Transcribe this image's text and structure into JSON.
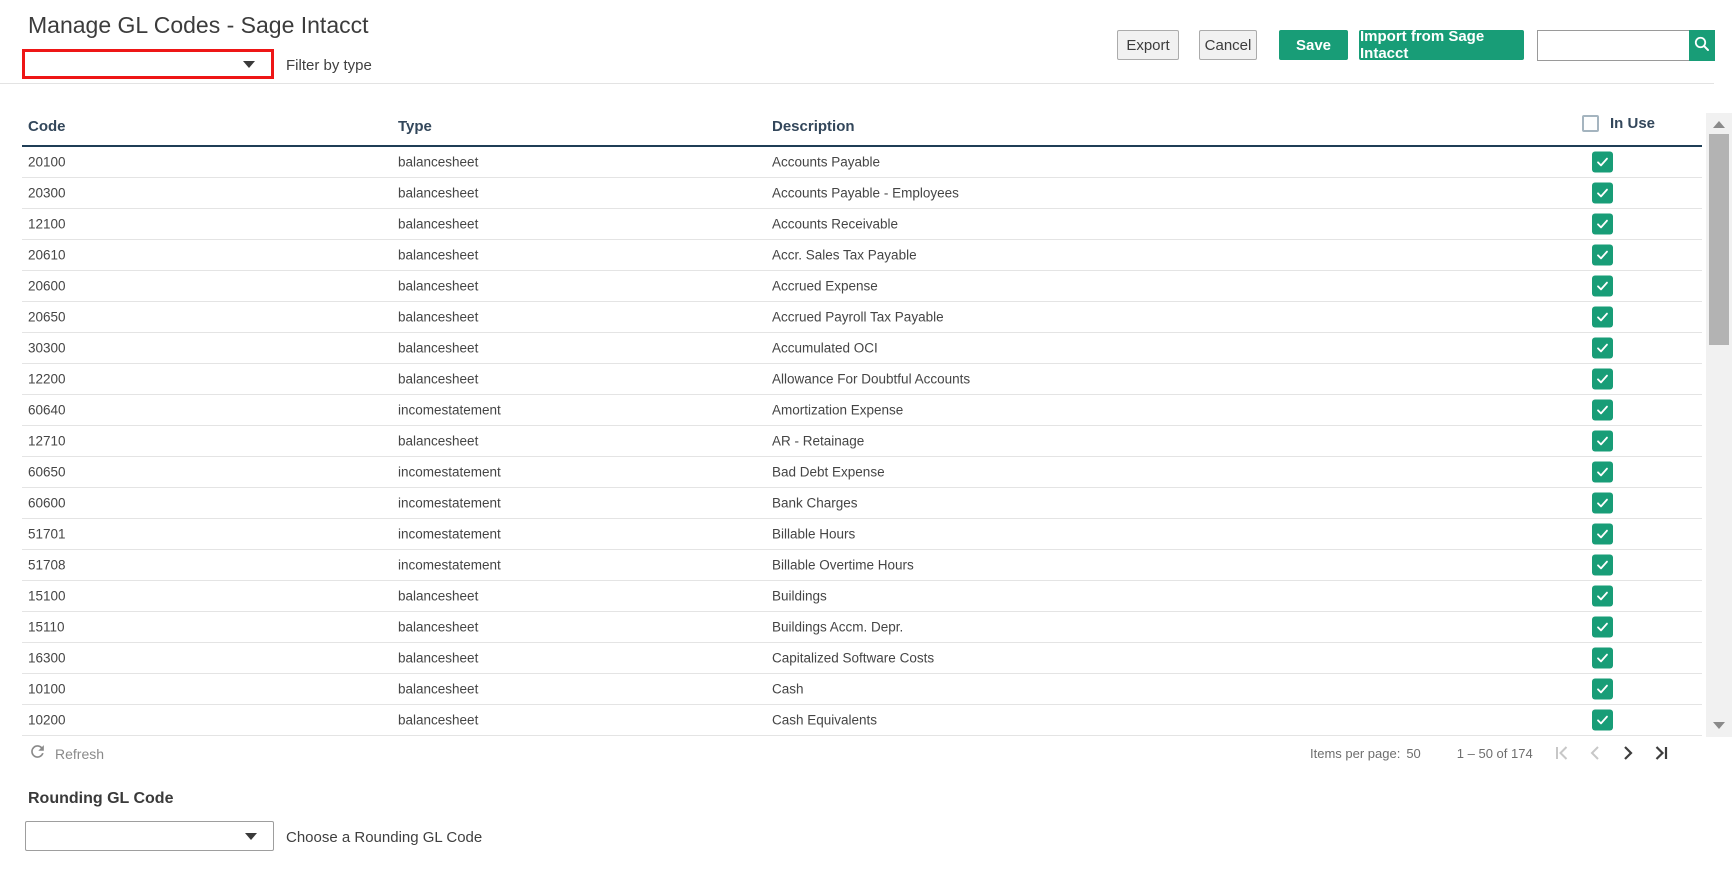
{
  "page": {
    "title": "Manage GL Codes - Sage Intacct"
  },
  "filter": {
    "value": "",
    "label": "Filter by type"
  },
  "toolbar": {
    "export_label": "Export",
    "cancel_label": "Cancel",
    "save_label": "Save",
    "import_label": "Import from Sage Intacct",
    "search_value": ""
  },
  "table": {
    "columns": {
      "code": "Code",
      "type": "Type",
      "description": "Description",
      "in_use": "In Use"
    },
    "header_checkbox_checked": false,
    "rows": [
      {
        "code": "20100",
        "type": "balancesheet",
        "description": "Accounts Payable",
        "in_use": true
      },
      {
        "code": "20300",
        "type": "balancesheet",
        "description": "Accounts Payable - Employees",
        "in_use": true
      },
      {
        "code": "12100",
        "type": "balancesheet",
        "description": "Accounts Receivable",
        "in_use": true
      },
      {
        "code": "20610",
        "type": "balancesheet",
        "description": "Accr. Sales Tax Payable",
        "in_use": true
      },
      {
        "code": "20600",
        "type": "balancesheet",
        "description": "Accrued Expense",
        "in_use": true
      },
      {
        "code": "20650",
        "type": "balancesheet",
        "description": "Accrued Payroll Tax Payable",
        "in_use": true
      },
      {
        "code": "30300",
        "type": "balancesheet",
        "description": "Accumulated OCI",
        "in_use": true
      },
      {
        "code": "12200",
        "type": "balancesheet",
        "description": "Allowance For Doubtful Accounts",
        "in_use": true
      },
      {
        "code": "60640",
        "type": "incomestatement",
        "description": "Amortization Expense",
        "in_use": true
      },
      {
        "code": "12710",
        "type": "balancesheet",
        "description": "AR - Retainage",
        "in_use": true
      },
      {
        "code": "60650",
        "type": "incomestatement",
        "description": "Bad Debt Expense",
        "in_use": true
      },
      {
        "code": "60600",
        "type": "incomestatement",
        "description": "Bank Charges",
        "in_use": true
      },
      {
        "code": "51701",
        "type": "incomestatement",
        "description": "Billable Hours",
        "in_use": true
      },
      {
        "code": "51708",
        "type": "incomestatement",
        "description": "Billable Overtime Hours",
        "in_use": true
      },
      {
        "code": "15100",
        "type": "balancesheet",
        "description": "Buildings",
        "in_use": true
      },
      {
        "code": "15110",
        "type": "balancesheet",
        "description": "Buildings Accm. Depr.",
        "in_use": true
      },
      {
        "code": "16300",
        "type": "balancesheet",
        "description": "Capitalized Software Costs",
        "in_use": true
      },
      {
        "code": "10100",
        "type": "balancesheet",
        "description": "Cash",
        "in_use": true
      },
      {
        "code": "10200",
        "type": "balancesheet",
        "description": "Cash Equivalents",
        "in_use": true
      }
    ]
  },
  "footer": {
    "refresh_label": "Refresh",
    "items_per_page_label": "Items per page:",
    "items_per_page_value": "50",
    "range_text": "1 – 50 of 174"
  },
  "rounding": {
    "heading": "Rounding GL Code",
    "value": "",
    "helper": "Choose a Rounding GL Code"
  },
  "icons": {
    "search": "magnifier",
    "refresh": "circular-arrow",
    "first_page": "bar-chevron-left",
    "previous_page": "chevron-left",
    "next_page": "chevron-right",
    "last_page": "chevron-right-bar",
    "combo_caret": "triangle-down",
    "checked": "white-check"
  },
  "colors": {
    "accent_green": "#189d77",
    "highlight_red": "#ee1616",
    "header_text": "#33475b",
    "header_underline": "#1f3e56"
  }
}
